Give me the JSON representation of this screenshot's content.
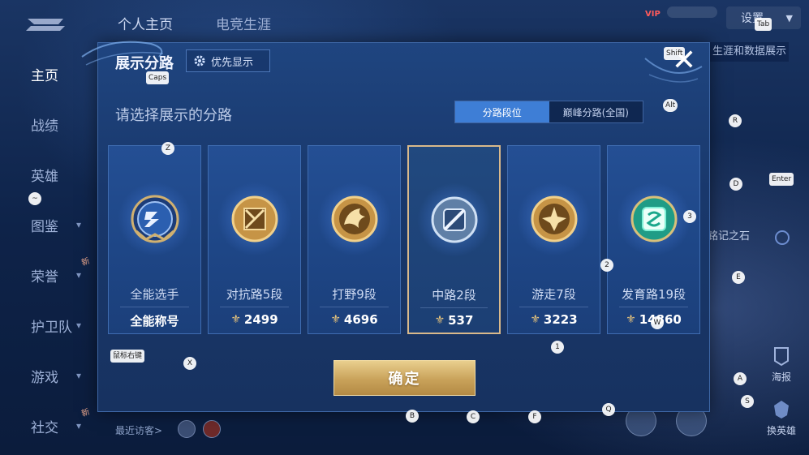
{
  "top_tabs": [
    "个人主页",
    "电竞生涯"
  ],
  "left_nav": [
    {
      "label": "主页",
      "active": true,
      "chevron": false,
      "new": false
    },
    {
      "label": "战绩",
      "active": false,
      "chevron": false,
      "new": false
    },
    {
      "label": "英雄",
      "active": false,
      "chevron": false,
      "new": false
    },
    {
      "label": "图鉴",
      "active": false,
      "chevron": true,
      "new": false
    },
    {
      "label": "荣誉",
      "active": false,
      "chevron": true,
      "new": true
    },
    {
      "label": "护卫队",
      "active": false,
      "chevron": true,
      "new": false
    },
    {
      "label": "游戏",
      "active": false,
      "chevron": true,
      "new": false
    },
    {
      "label": "社交",
      "active": false,
      "chevron": true,
      "new": true
    }
  ],
  "new_tag": "新",
  "header_right": {
    "vip_label": "VIP",
    "settings_label": "设置",
    "data_show_label": "生涯和数据展示"
  },
  "background_labels": {
    "stone_label": "铭记之石",
    "poster_label": "海报",
    "switch_hero_label": "换英雄",
    "recent_visitors": "最近访客>"
  },
  "modal": {
    "title": "展示分路",
    "priority_button": "优先显示",
    "subtitle": "请选择展示的分路",
    "segments": [
      {
        "label": "分路段位",
        "active": true
      },
      {
        "label": "巅峰分路(全国)",
        "active": false
      }
    ],
    "cards": [
      {
        "name": "全能选手",
        "score": "全能称号",
        "show_icon": false,
        "selected": false,
        "emblem": "allround",
        "color": "#9fb8e6"
      },
      {
        "name": "对抗路5段",
        "score": "2499",
        "show_icon": true,
        "selected": false,
        "emblem": "clash",
        "color": "#d8a855"
      },
      {
        "name": "打野9段",
        "score": "4696",
        "show_icon": true,
        "selected": false,
        "emblem": "jungle",
        "color": "#d8a855"
      },
      {
        "name": "中路2段",
        "score": "537",
        "show_icon": true,
        "selected": true,
        "emblem": "mid",
        "color": "#8fb3d9"
      },
      {
        "name": "游走7段",
        "score": "3223",
        "show_icon": true,
        "selected": false,
        "emblem": "roam",
        "color": "#d8a855"
      },
      {
        "name": "发育路19段",
        "score": "14860",
        "show_icon": true,
        "selected": false,
        "emblem": "farm",
        "color": "#2fc7a6"
      }
    ],
    "confirm_label": "确定"
  },
  "key_hints": [
    "Tab",
    "Shift",
    "Caps",
    "Alt",
    "R",
    "Z",
    "D",
    "Enter",
    "~",
    "3",
    "2",
    "E",
    "W",
    "1",
    "鼠标右键",
    "X",
    "A",
    "S",
    "B",
    "C",
    "F",
    "Q"
  ]
}
